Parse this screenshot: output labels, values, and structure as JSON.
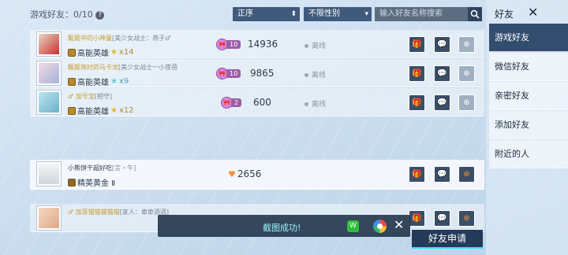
{
  "header": {
    "friend_count": "游戏好友：0/10",
    "help": "?",
    "sort": "正序",
    "gender": "不限性别",
    "search_placeholder": "输入好友名称搜索"
  },
  "side": {
    "title": "好友",
    "tabs": [
      "游戏好友",
      "微信好友",
      "亲密好友",
      "添加好友",
      "附近的人"
    ]
  },
  "rows": [
    {
      "nick": "甄姬中的小神童",
      "tag": "[美少女战士：燕子♂",
      "rank": "高能英雄",
      "stars": "x14",
      "intimacy": "10",
      "score": "14936",
      "status": "离线"
    },
    {
      "nick": "甄姬亮时的马卡龙",
      "tag": "[美少女战士一小夜蓓",
      "rank": "高能英雄",
      "stars": "x9",
      "intimacy": "10",
      "score": "9865",
      "status": "离线"
    },
    {
      "nick": "♂ 加号宝",
      "tag": "[相守]",
      "rank": "高能英雄",
      "stars": "x12",
      "intimacy": "2",
      "score": "600",
      "status": "离线"
    },
    {
      "nick": "小熊饼干超好吃",
      "tag": "[言・午]",
      "rank": "精英黄金 Ⅱ",
      "stars": "",
      "intimacy": "",
      "score": "2656",
      "status": ""
    },
    {
      "nick": "♂ 加菲猫猫猫猫猫",
      "tag": "[家人：車車酒酒]",
      "rank": "",
      "stars": "",
      "intimacy": "",
      "score": "",
      "status": ""
    }
  ],
  "toast": {
    "text": "截图成功!"
  },
  "request_button": "好友申请",
  "icons": {
    "gift": "gift-icon",
    "chat": "chat-icon",
    "pk": "battle-icon",
    "close": "close-icon"
  }
}
